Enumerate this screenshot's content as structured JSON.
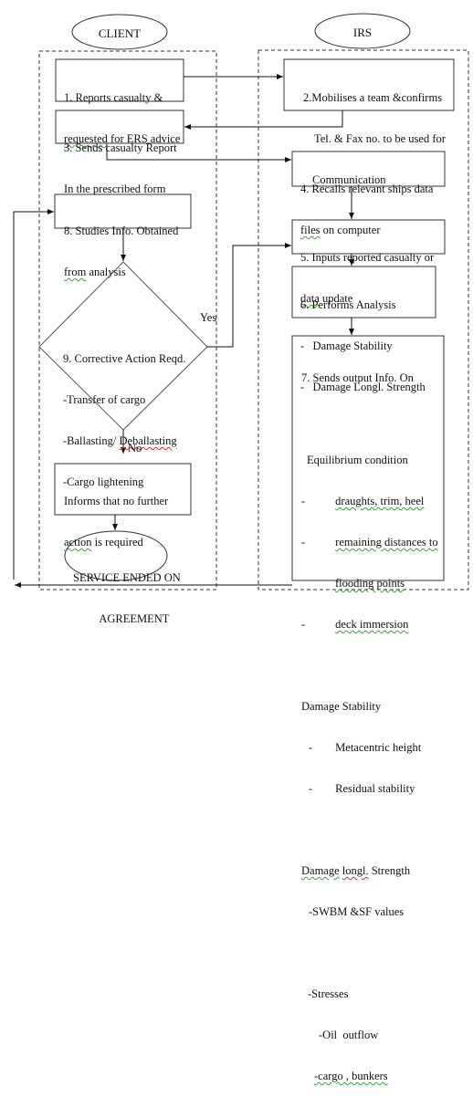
{
  "lanes": {
    "client": {
      "title": "CLIENT"
    },
    "irs": {
      "title": "IRS"
    }
  },
  "nodes": {
    "n1": {
      "lines": [
        "1. Reports casualty &",
        "requested for ERS advice"
      ]
    },
    "n2": {
      "lines": [
        "2.Mobilises a team &confirms",
        "Tel. & Fax no. to be used for",
        "Communication"
      ]
    },
    "n3": {
      "lines": [
        "3. Sends casualty Report",
        "In the prescribed form"
      ]
    },
    "n4": {
      "lines": [
        "4. Recalls relevant ships data",
        "files on computer"
      ]
    },
    "n5": {
      "lines": [
        "5. Inputs reported casualty or",
        "data update"
      ]
    },
    "n6": {
      "lines": [
        "6. Performs Analysis",
        "-   Damage Stability",
        "-   Damage Longl. Strength"
      ]
    },
    "n7": {
      "title": "7. Sends output Info. On",
      "sections": [
        {
          "heading": "Equilibrium condition",
          "items": [
            "draughts, trim, heel",
            "remaining distances to",
            "flooding points",
            "deck immersion"
          ]
        },
        {
          "heading": "Damage Stability",
          "items": [
            "Metacentric height",
            "Residual stability"
          ]
        },
        {
          "heading": "Damage longl. Strength",
          "items": [
            "-SWBM &SF values"
          ]
        },
        {
          "heading": "-Stresses",
          "items": [
            "-Oil  outflow",
            "-cargo , bunkers"
          ]
        }
      ]
    },
    "n8": {
      "lines": [
        "8. Studies Info. Obtained",
        "from analysis"
      ]
    },
    "n9": {
      "lines": [
        "9. Corrective Action Reqd.",
        "-Transfer of cargo",
        "-Ballasting/ Deballasting",
        "-Cargo lightening"
      ]
    },
    "n10": {
      "lines": [
        "Informs that no further",
        "action is required"
      ]
    },
    "end": {
      "lines": [
        "SERVICE ENDED ON",
        "AGREEMENT"
      ]
    }
  },
  "edge_labels": {
    "yes": "Yes",
    "no": "No"
  }
}
